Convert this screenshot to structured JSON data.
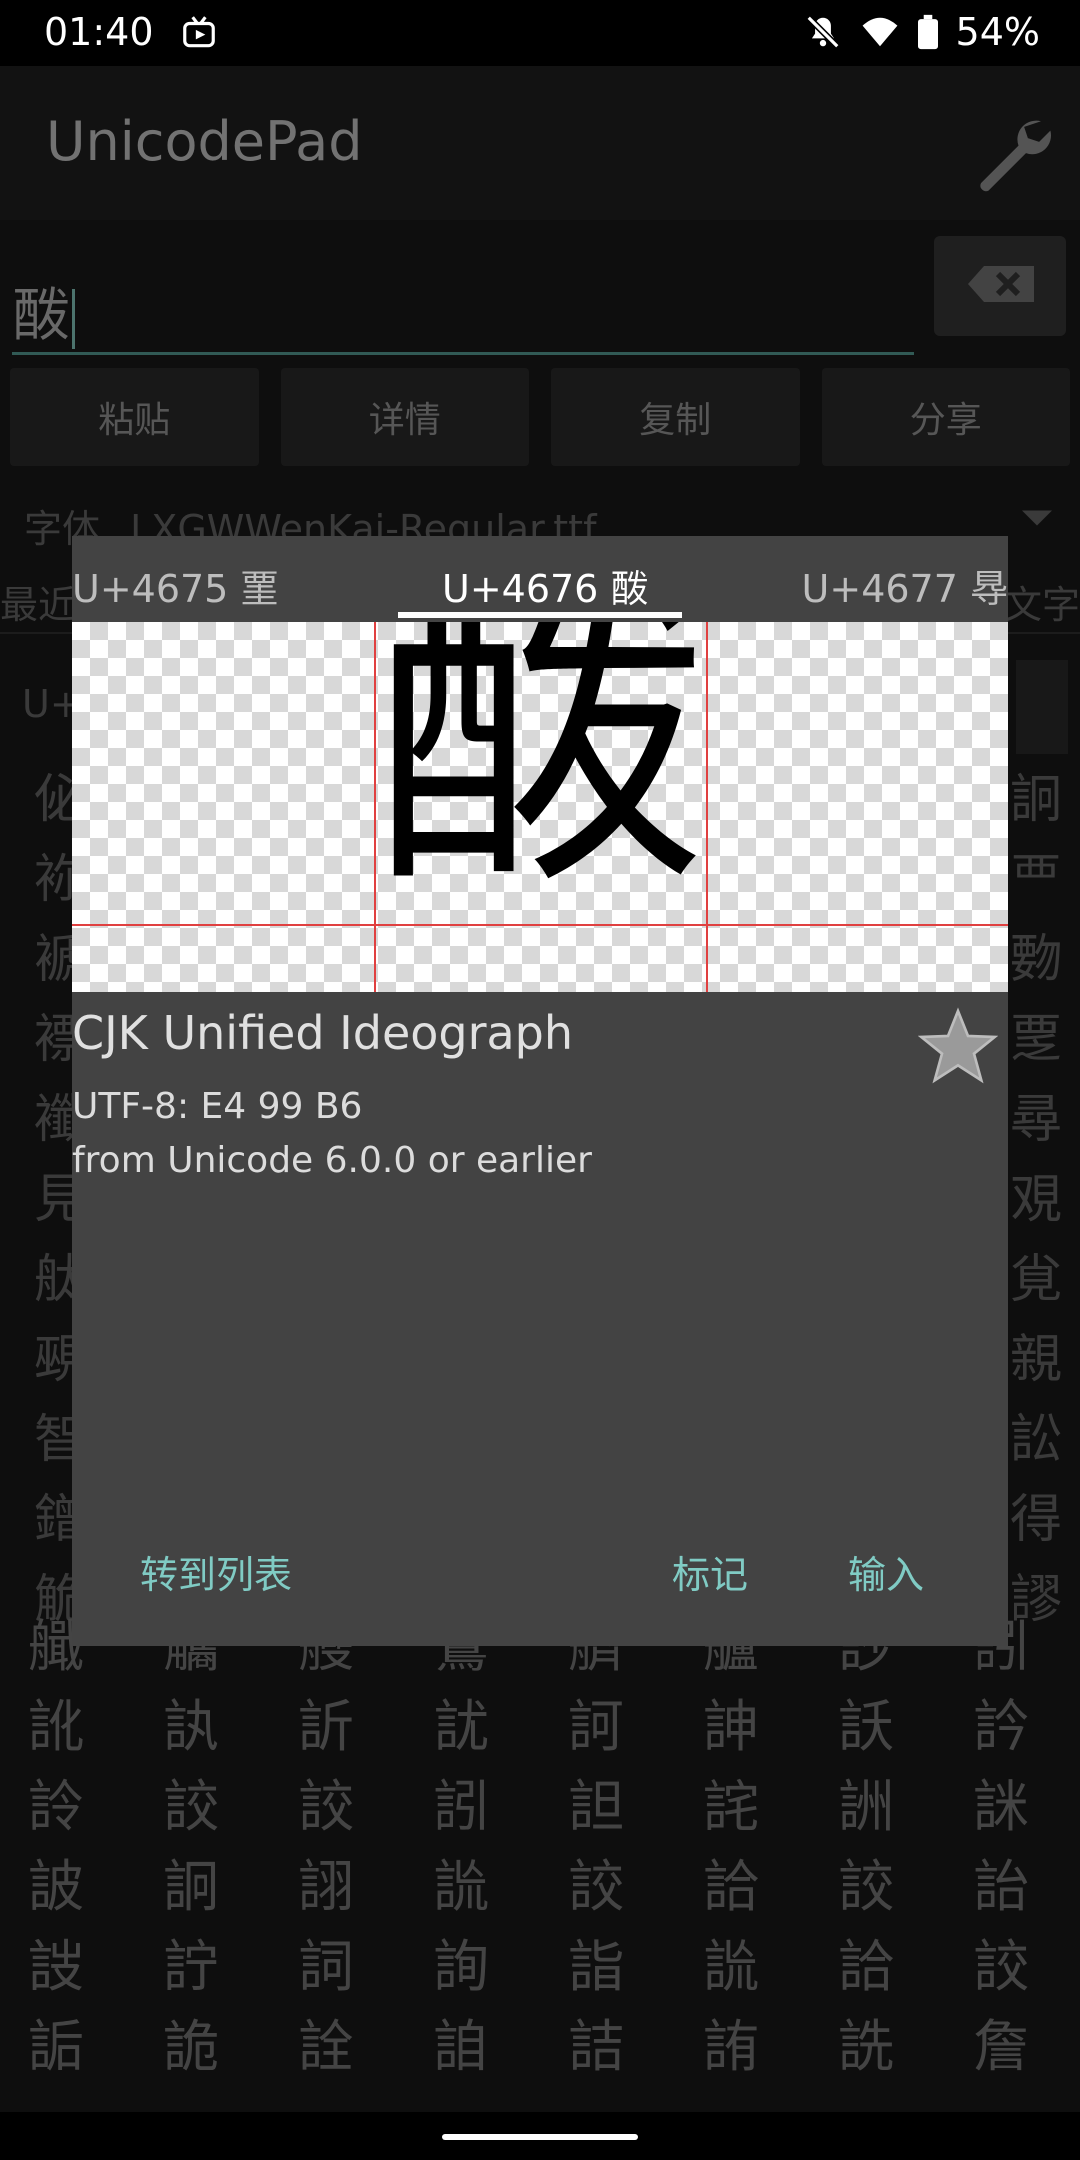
{
  "status_bar": {
    "time": "01:40",
    "battery": "54%"
  },
  "app_bar": {
    "title": "UnicodePad"
  },
  "input": {
    "value": "酦"
  },
  "buttons": {
    "paste": "粘贴",
    "details": "详情",
    "copy": "复制",
    "share": "分享"
  },
  "font": {
    "label": "字体",
    "value": "LXGWWenKai-Regular.ttf"
  },
  "background": {
    "tab_left": "最近",
    "tab_right": "文字",
    "list_prefix": "U+",
    "left_column": [
      "佖",
      "袮",
      "褫",
      "褾",
      "襳",
      "見",
      "舦",
      "覡",
      "智",
      "鏳",
      "觤"
    ],
    "right_column": [
      "詗",
      "覀",
      "覅",
      "覂",
      "尋",
      "覌",
      "覍",
      "親",
      "訟",
      "得",
      "謬"
    ],
    "grid": [
      "艥",
      "觿",
      "艭",
      "鷟",
      "艩",
      "艫",
      "訬",
      "訠",
      "訛",
      "訙",
      "訢",
      "訧",
      "訶",
      "訷",
      "訞",
      "訡",
      "詅",
      "詨",
      "詨",
      "訠",
      "詚",
      "詫",
      "詶",
      "詸",
      "詖",
      "詗",
      "詡",
      "詤",
      "詨",
      "詥",
      "詨",
      "詒",
      "詜",
      "詝",
      "詞",
      "詢",
      "詣",
      "詤",
      "詥",
      "詨",
      "詬",
      "詭",
      "詮",
      "詯",
      "詰",
      "詴",
      "詵",
      "詹"
    ]
  },
  "dialog": {
    "prev_tab": "U+4675 䙵",
    "current_tab": "U+4676 酦",
    "next_tab": "U+4677 䙷",
    "glyph": "酦",
    "name": "CJK Unified Ideograph",
    "utf8": "UTF-8: E4 99 B6",
    "version": "from Unicode 6.0.0 or earlier",
    "actions": {
      "goto_list": "转到列表",
      "mark": "标记",
      "input": "输入"
    }
  }
}
